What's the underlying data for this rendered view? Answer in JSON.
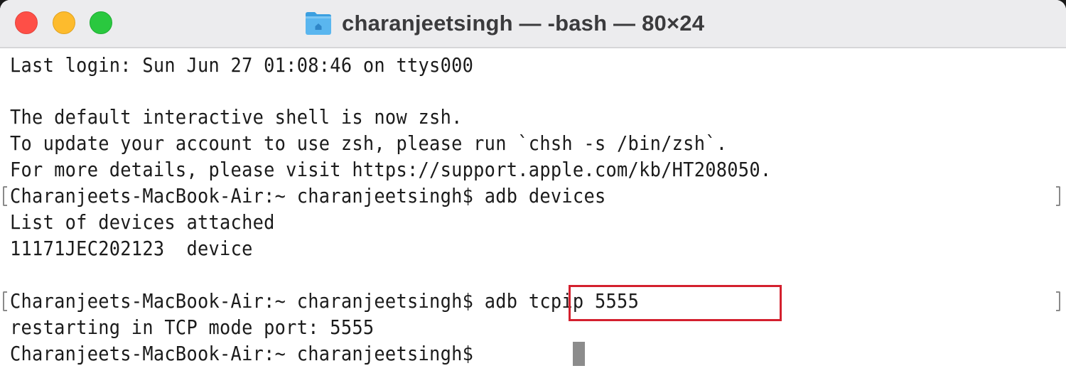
{
  "window": {
    "title": "charanjeetsingh — -bash — 80×24",
    "folder_icon": "home-folder-icon",
    "traffic_lights": {
      "close_color": "#fe4f47",
      "minimize_color": "#fdbb2d",
      "zoom_color": "#2ac83f"
    }
  },
  "terminal": {
    "lines": [
      "Last login: Sun Jun 27 01:08:46 on ttys000",
      "",
      "The default interactive shell is now zsh.",
      "To update your account to use zsh, please run `chsh -s /bin/zsh`.",
      "For more details, please visit https://support.apple.com/kb/HT208050.",
      "Charanjeets-MacBook-Air:~ charanjeetsingh$ adb devices",
      "List of devices attached",
      "11171JEC202123\tdevice",
      "",
      "Charanjeets-MacBook-Air:~ charanjeetsingh$ adb tcpip 5555",
      "restarting in TCP mode port: 5555",
      "Charanjeets-MacBook-Air:~ charanjeetsingh$ "
    ],
    "prompt": "Charanjeets-MacBook-Air:~ charanjeetsingh$",
    "commands": {
      "first": "adb devices",
      "second": "adb tcpip 5555"
    },
    "highlighted_command": "adb tcpip 5555",
    "highlight_color": "#d4202e",
    "device_list_header": "List of devices attached",
    "device_serial": "11171JEC202123",
    "device_state": "device",
    "tcp_output": "restarting in TCP mode port: 5555"
  }
}
